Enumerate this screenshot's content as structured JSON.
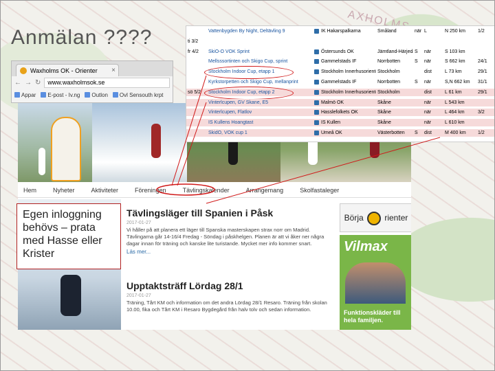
{
  "slide": {
    "title": "Anmälan ????",
    "callout": "Egen inloggning behövs – prata med Hasse eller Krister",
    "map_word": "AXHOLMS"
  },
  "browser": {
    "tab_title": "Waxholms OK - Orienter",
    "url": "www.waxholmsok.se",
    "bookmarks": [
      "Appar",
      "E-post - Iv.ng",
      "Outlon",
      "Ovl Sensouth krpt"
    ]
  },
  "site": {
    "nav": [
      "Hem",
      "Nyheter",
      "Aktiviteter",
      "Föreningen",
      "Tävlingskalender",
      "Arrangemang",
      "Skolfastaleger"
    ],
    "posts": [
      {
        "title": "Tävlingsläger till Spanien i Påsk",
        "date": "2017-01-27",
        "body": "Vi håller på att planera ett läger till Spanska masterskapen strax norr om Madrid. Tävlingarna går 14-16/4 Fredag - Söndag i påskhelgen. Planen är att vi åker ner några dagar innan för träning och kanske lite turistande. Mycket mer info kommer snart.",
        "more": "Läs mer..."
      },
      {
        "title": "Upptaktsträff Lördag 28/1",
        "date": "2017-01-27",
        "body": "Träning, Tårt KM och information om det andra Lördag 28/1 Resaro. Träning från skolan 10.00, fika och Tårt KM i Resaro Bygdegård från halv tolv och sedan information.",
        "more": ""
      }
    ],
    "ad1": {
      "left": "Börja",
      "right": "rienter"
    },
    "ad2": {
      "logo": "Vilmax",
      "caption": "Funktionskläder till hela familjen."
    }
  },
  "competitions": {
    "rows": [
      {
        "date": "",
        "name": "Vattenbygden By Night, Deltävling 9",
        "club": "IK Hakarspalkarna",
        "district": "Småland",
        "type": "när",
        "len": "L",
        "dist": "N 250 km",
        "dl": "1/2",
        "hl": false,
        "ring": false
      },
      {
        "date": "ti 3/2",
        "name": "",
        "club": "",
        "district": "",
        "type": "",
        "len": "",
        "dist": "",
        "dl": "",
        "hl": false,
        "ring": false
      },
      {
        "date": "fr 4/2",
        "name": "SkiO-O VOK Sprint",
        "club": "Östersunds OK",
        "district": "Jämtland-Härjedalen",
        "type": "S",
        "len": "när",
        "dist": "S 103 km",
        "dl": "",
        "hl": false,
        "ring": false
      },
      {
        "date": "",
        "name": "Mellsssortinten och Skigo Cup, sprint",
        "club": "Gammelstads IF",
        "district": "Norrbotten",
        "type": "S",
        "len": "när",
        "dist": "S 662 km",
        "dl": "24/1",
        "hl": false,
        "ring": false
      },
      {
        "date": "",
        "name": "Stockholm Indoor Cup, etapp 1",
        "club": "Stockholm Innerhusorienterare",
        "district": "Stockholm",
        "type": "",
        "len": "dist",
        "dist": "L 73 km",
        "dl": "29/1",
        "hl": false,
        "ring": true
      },
      {
        "date": "",
        "name": "Kyrkstorpetten och Skigo Cup, mellanprint",
        "club": "Gammelstads IF",
        "district": "Norrbotten",
        "type": "S",
        "len": "när",
        "dist": "S,N 662 km",
        "dl": "31/1",
        "hl": false,
        "ring": false
      },
      {
        "date": "sö 5/2",
        "name": "Stockholm Indoor Cup, etapp 2",
        "club": "Stockholm Innerhusorienterare",
        "district": "Stockholm",
        "type": "",
        "len": "dist",
        "dist": "L 61 km",
        "dl": "29/1",
        "hl": true,
        "ring": true
      },
      {
        "date": "",
        "name": "Vinterlcupen, GV Skane, E5",
        "club": "Malmö OK",
        "district": "Skåne",
        "type": "",
        "len": "när",
        "dist": "L 543 km",
        "dl": "",
        "hl": true,
        "ring": false
      },
      {
        "date": "",
        "name": "Vinterlcupen, Flatlov",
        "club": "Hasslefolkets OK",
        "district": "Skåne",
        "type": "",
        "len": "när",
        "dist": "L 464 km",
        "dl": "3/2",
        "hl": true,
        "ring": false
      },
      {
        "date": "",
        "name": "IS Kullens Hoangtast",
        "club": "IS Kullen",
        "district": "Skåne",
        "type": "",
        "len": "när",
        "dist": "L 610 km",
        "dl": "",
        "hl": true,
        "ring": false
      },
      {
        "date": "",
        "name": "SkidO, VOK cup 1",
        "club": "Umeå OK",
        "district": "Västerbotten",
        "type": "S",
        "len": "dist",
        "dist": "M 400 km",
        "dl": "1/2",
        "hl": true,
        "ring": false
      }
    ]
  }
}
